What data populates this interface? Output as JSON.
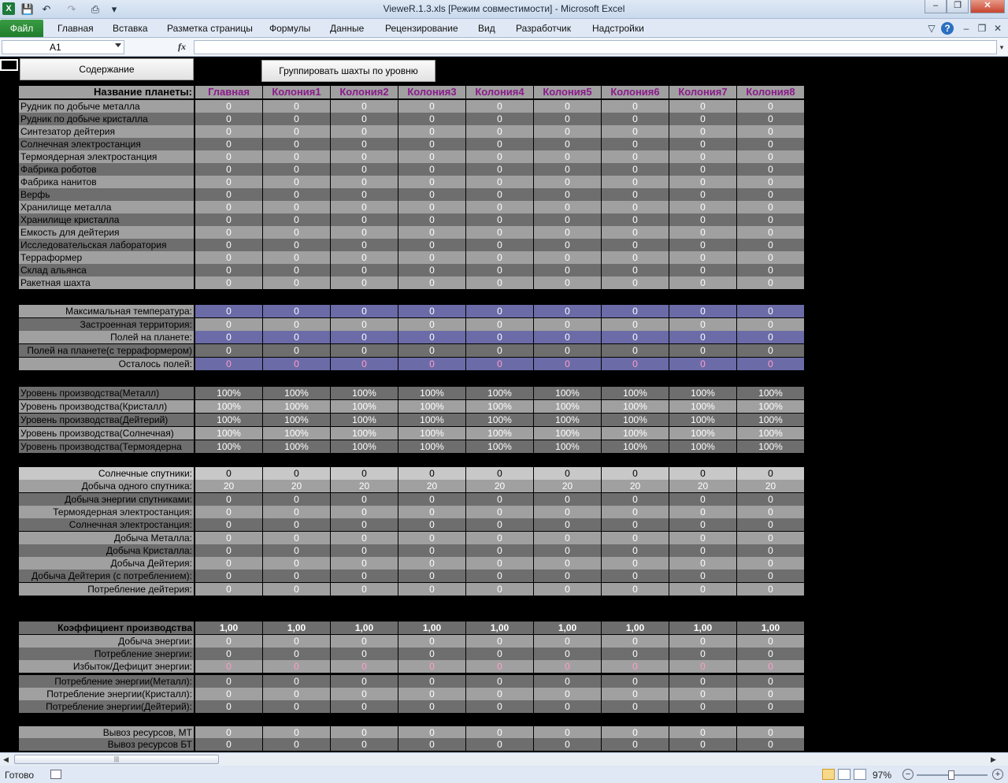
{
  "window": {
    "title": "ViewеR.1.3.xls  [Режим совместимости]  -  Microsoft Excel",
    "app_icon": "excel-icon",
    "min": "–",
    "restore": "❐",
    "close": "✕"
  },
  "quick_access": {
    "save": "💾",
    "undo": "↶",
    "redo": "↷",
    "print": "⎙",
    "more": "▾"
  },
  "ribbon": {
    "file": "Файл",
    "tabs": [
      "Главная",
      "Вставка",
      "Разметка страницы",
      "Формулы",
      "Данные",
      "Рецензирование",
      "Вид",
      "Разработчик",
      "Надстройки"
    ],
    "help": "?"
  },
  "formula_bar": {
    "name_box": "A1",
    "fx": "fx",
    "value": ""
  },
  "buttons": {
    "contents": "Содержание",
    "group": "Группировать шахты по уровню"
  },
  "columns": [
    "Главная",
    "Колония1",
    "Колония2",
    "Колония3",
    "Колония4",
    "Колония5",
    "Колония6",
    "Колония7",
    "Колония8"
  ],
  "header_label": "Название планеты:",
  "buildings": [
    "Рудник по добыче металла",
    "Рудник по добыче кристалла",
    "Синтезатор дейтерия",
    "Солнечная электростанция",
    "Термоядерная электростанция",
    "Фабрика роботов",
    "Фабрика нанитов",
    "Верфь",
    "Хранилище металла",
    "Хранилище кристалла",
    "Емкость для дейтерия",
    "Исследовательская лаборатория",
    "Терраформер",
    "Склад альянса",
    "Ракетная шахта"
  ],
  "fields": [
    {
      "label": "Максимальная температура:",
      "value": "0"
    },
    {
      "label": "Застроенная территория:",
      "value": "0"
    },
    {
      "label": "Полей на планете:",
      "value": "0"
    },
    {
      "label": "Полей на планете(с терраформером)",
      "value": "0"
    },
    {
      "label": "Осталось полей:",
      "value": "0"
    }
  ],
  "production_levels": {
    "labels": [
      "Уровень производства(Металл)",
      "Уровень производства(Кристалл)",
      "Уровень производства(Дейтерий)",
      "Уровень производства(Солнечная)",
      "Уровень производства(Термоядерна"
    ],
    "value": "100%"
  },
  "energy": [
    {
      "label": "Солнечные спутники:",
      "value": "0"
    },
    {
      "label": "Добыча одного спутника:",
      "value": "20"
    },
    {
      "label": "Добыча энергии спутниками:",
      "value": "0"
    },
    {
      "label": "Термоядерная электростанция:",
      "value": "0"
    },
    {
      "label": "Солнечная электростанция:",
      "value": "0"
    },
    {
      "label": "Добыча Металла:",
      "value": "0"
    },
    {
      "label": "Добыча Кристалла:",
      "value": "0"
    },
    {
      "label": "Добыча Дейтерия:",
      "value": "0"
    },
    {
      "label": "Добыча Дейтерия (с потреблением):",
      "value": "0"
    },
    {
      "label": "Потребление дейтерия:",
      "value": "0"
    }
  ],
  "coefficient": {
    "label": "Коэффициент производства",
    "value": "1,00"
  },
  "consumption": [
    {
      "label": "Добыча энергии:",
      "value": "0"
    },
    {
      "label": "Потребление энергии:",
      "value": "0"
    },
    {
      "label": "Избыток/Дефицит энергии:",
      "value": "0"
    },
    {
      "label": "Потребление энергии(Металл):",
      "value": "0"
    },
    {
      "label": "Потребление энергии(Кристалл):",
      "value": "0"
    },
    {
      "label": "Потребление энергии(Дейтерий):",
      "value": "0"
    }
  ],
  "export": [
    {
      "label": "Вывоз ресурсов, МТ",
      "value": "0"
    },
    {
      "label": "Вывоз ресурсов БТ",
      "value": "0"
    }
  ],
  "status": {
    "ready": "Готово",
    "zoom": "97%",
    "zoom_out": "−",
    "zoom_in": "+",
    "scroll_left": "◀",
    "scroll_right": "▶",
    "scroll_grip": "|||"
  },
  "colors": {
    "cell_gray_light": "#a0a0a0",
    "cell_gray_dark": "#6e6e6e",
    "cell_purple": "#6b6ba8",
    "header_text": "#8b1a8b",
    "pink_text": "#ff9ec8"
  }
}
